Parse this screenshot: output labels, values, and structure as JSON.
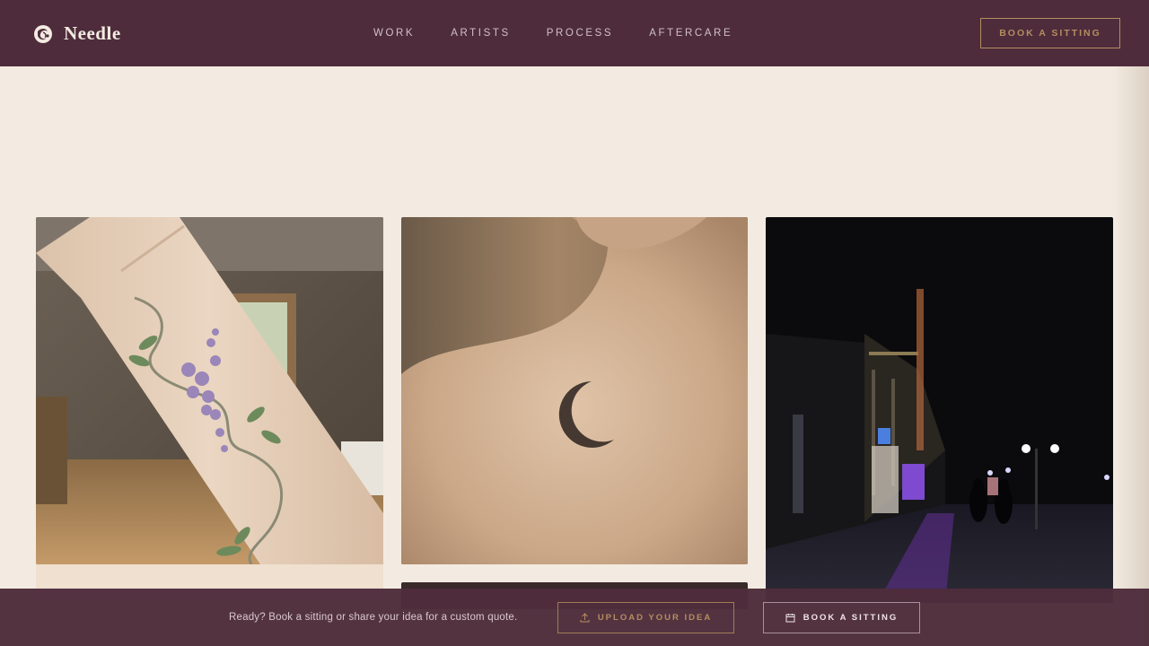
{
  "brand": {
    "name": "Needle",
    "icon": "needle-logo-icon"
  },
  "nav": {
    "items": [
      "WORK",
      "ARTISTS",
      "PROCESS",
      "AFTERCARE"
    ]
  },
  "header": {
    "book_label": "BOOK A SITTING"
  },
  "gallery": {
    "tiles": [
      {
        "name": "wisteria-forearm-tattoo"
      },
      {
        "name": "crescent-moon-shoulder-tattoo"
      },
      {
        "name": "night-street-photo"
      }
    ]
  },
  "cta": {
    "text": "Ready? Book a sitting or share your idea for a custom quote.",
    "upload_label": "UPLOAD YOUR IDEA",
    "upload_icon": "upload-icon",
    "book_label": "BOOK A SITTING",
    "book_icon": "calendar-icon"
  },
  "colors": {
    "plum": "#4e2c3c",
    "cream": "#f3ebe1",
    "gold": "#b48d5f"
  }
}
